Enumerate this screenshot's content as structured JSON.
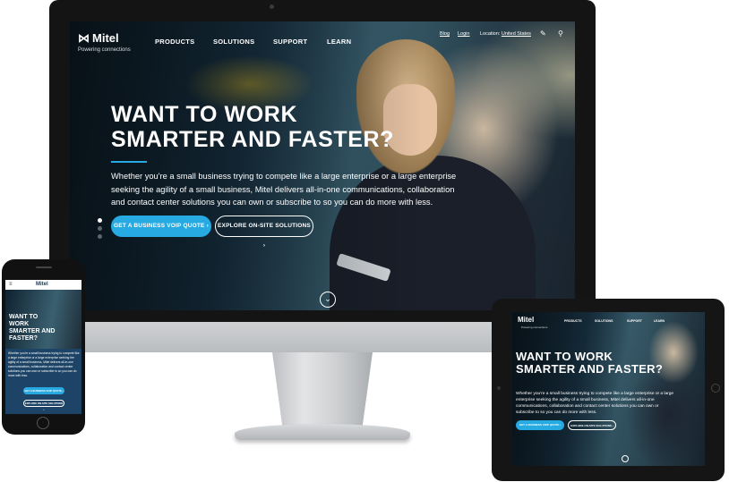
{
  "desktop": {
    "logo": {
      "mark": "⋈",
      "name": "Mitel",
      "tagline": "Powering connections"
    },
    "nav": [
      "PRODUCTS",
      "SOLUTIONS",
      "SUPPORT",
      "LEARN"
    ],
    "utility": {
      "blog": "Blog",
      "login": "Login",
      "location_label": "Location:",
      "location_value": "United States"
    },
    "headline_line1": "WANT TO WORK",
    "headline_line2": "SMARTER AND FASTER?",
    "paragraph": "Whether you're a small business trying to compete like a large enterprise or a large enterprise seeking the agility of a small business, Mitel delivers all-in-one communications, collaboration and contact center solutions you can own or subscribe to so you can do more with less.",
    "cta_primary": "GET A BUSINESS VOIP QUOTE ›",
    "cta_secondary": "EXPLORE ON-SITE SOLUTIONS ›"
  },
  "phone": {
    "logo": "Mitel",
    "menu_icon": "≡",
    "headline_line1": "WANT TO WORK",
    "headline_line2": "SMARTER AND",
    "headline_line3": "FASTER?",
    "paragraph": "Whether you're a small business trying to compete like a large enterprise or a large enterprise seeking the agility of a small business, Mitel delivers all-in-one communications, collaboration and contact center solutions you can own or subscribe to so you can do more with less.",
    "cta_primary": "GET A BUSINESS VOIP QUOTE ›",
    "cta_secondary": "EXPLORE ON-SITE SOLUTIONS ›"
  },
  "tablet": {
    "logo": "Mitel",
    "tagline": "Powering connections",
    "nav": [
      "PRODUCTS",
      "SOLUTIONS",
      "SUPPORT",
      "LEARN"
    ],
    "headline_line1": "WANT TO WORK",
    "headline_line2": "SMARTER AND FASTER?",
    "paragraph": "Whether you're a small business trying to compete like a large enterprise or a large enterprise seeking the agility of a small business, Mitel delivers all-in-one communications, collaboration and contact center solutions you can own or subscribe to so you can do more with less.",
    "cta_primary": "GET A BUSINESS VOIP QUOTE ›",
    "cta_secondary": "EXPLORE ON-SITE SOLUTIONS ›"
  },
  "colors": {
    "accent": "#27a9e1",
    "navy": "#1d4466"
  },
  "icons": {
    "edit": "pencil-icon",
    "search": "search-icon",
    "scroll": "chevron-down-circle-icon"
  }
}
